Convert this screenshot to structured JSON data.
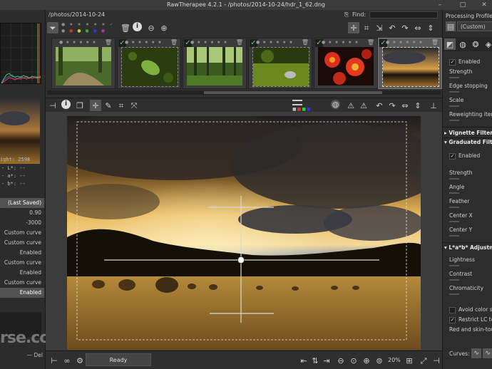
{
  "window": {
    "title": "RawTherapee 4.2.1 - /photos/2014-10-24/hdr_1_62.dng"
  },
  "file_browser": {
    "path": "/photos/2014-10-24",
    "find_label": "Find:",
    "find_value": ""
  },
  "thumbnails": [
    {
      "checked": false,
      "selected": false
    },
    {
      "checked": true,
      "selected": false
    },
    {
      "checked": true,
      "selected": false
    },
    {
      "checked": true,
      "selected": false
    },
    {
      "checked": true,
      "selected": false
    },
    {
      "checked": true,
      "selected": true
    }
  ],
  "navigator": {
    "width_text": "ight: 2598",
    "row1": "- L*: --",
    "row2": "- a*: --",
    "row3": "- b*: --"
  },
  "history": {
    "items": [
      {
        "label": "(Last Saved)",
        "selected": true
      },
      {
        "label": "0.90",
        "selected": false
      },
      {
        "label": "-3000",
        "selected": false
      },
      {
        "label": "Custom curve",
        "selected": false
      },
      {
        "label": "Custom curve",
        "selected": false
      },
      {
        "label": "Enabled",
        "selected": false
      },
      {
        "label": "Custom curve",
        "selected": false
      },
      {
        "label": "Enabled",
        "selected": false
      },
      {
        "label": "Custom curve",
        "selected": false
      },
      {
        "label": "Enabled",
        "selected": true
      }
    ]
  },
  "left_bottom": {
    "del_label": "Del",
    "watermark": "rse.com"
  },
  "status": {
    "ready_label": "Ready",
    "zoom": "20%"
  },
  "right_panel": {
    "header": "Processing Profiles",
    "profile_value": "(Custom)",
    "items": [
      "Enabled",
      "Strength",
      "Edge stopping",
      "Scale",
      "Reweighting itera",
      "Vignette Filter",
      "Graduated Filter",
      "Enabled",
      "Strength",
      "Angle",
      "Feather",
      "Center X",
      "Center Y",
      "L*a*b* Adjustm",
      "Lightness",
      "Contrast",
      "Chromaticity",
      "Avoid color sh",
      "Restrict LC to",
      "Red and skin-tone",
      "Curves:"
    ]
  },
  "colors": {
    "accent_check": "#5ad36a",
    "panel_bg": "#2d2d2d",
    "selected_row": "#525252"
  }
}
